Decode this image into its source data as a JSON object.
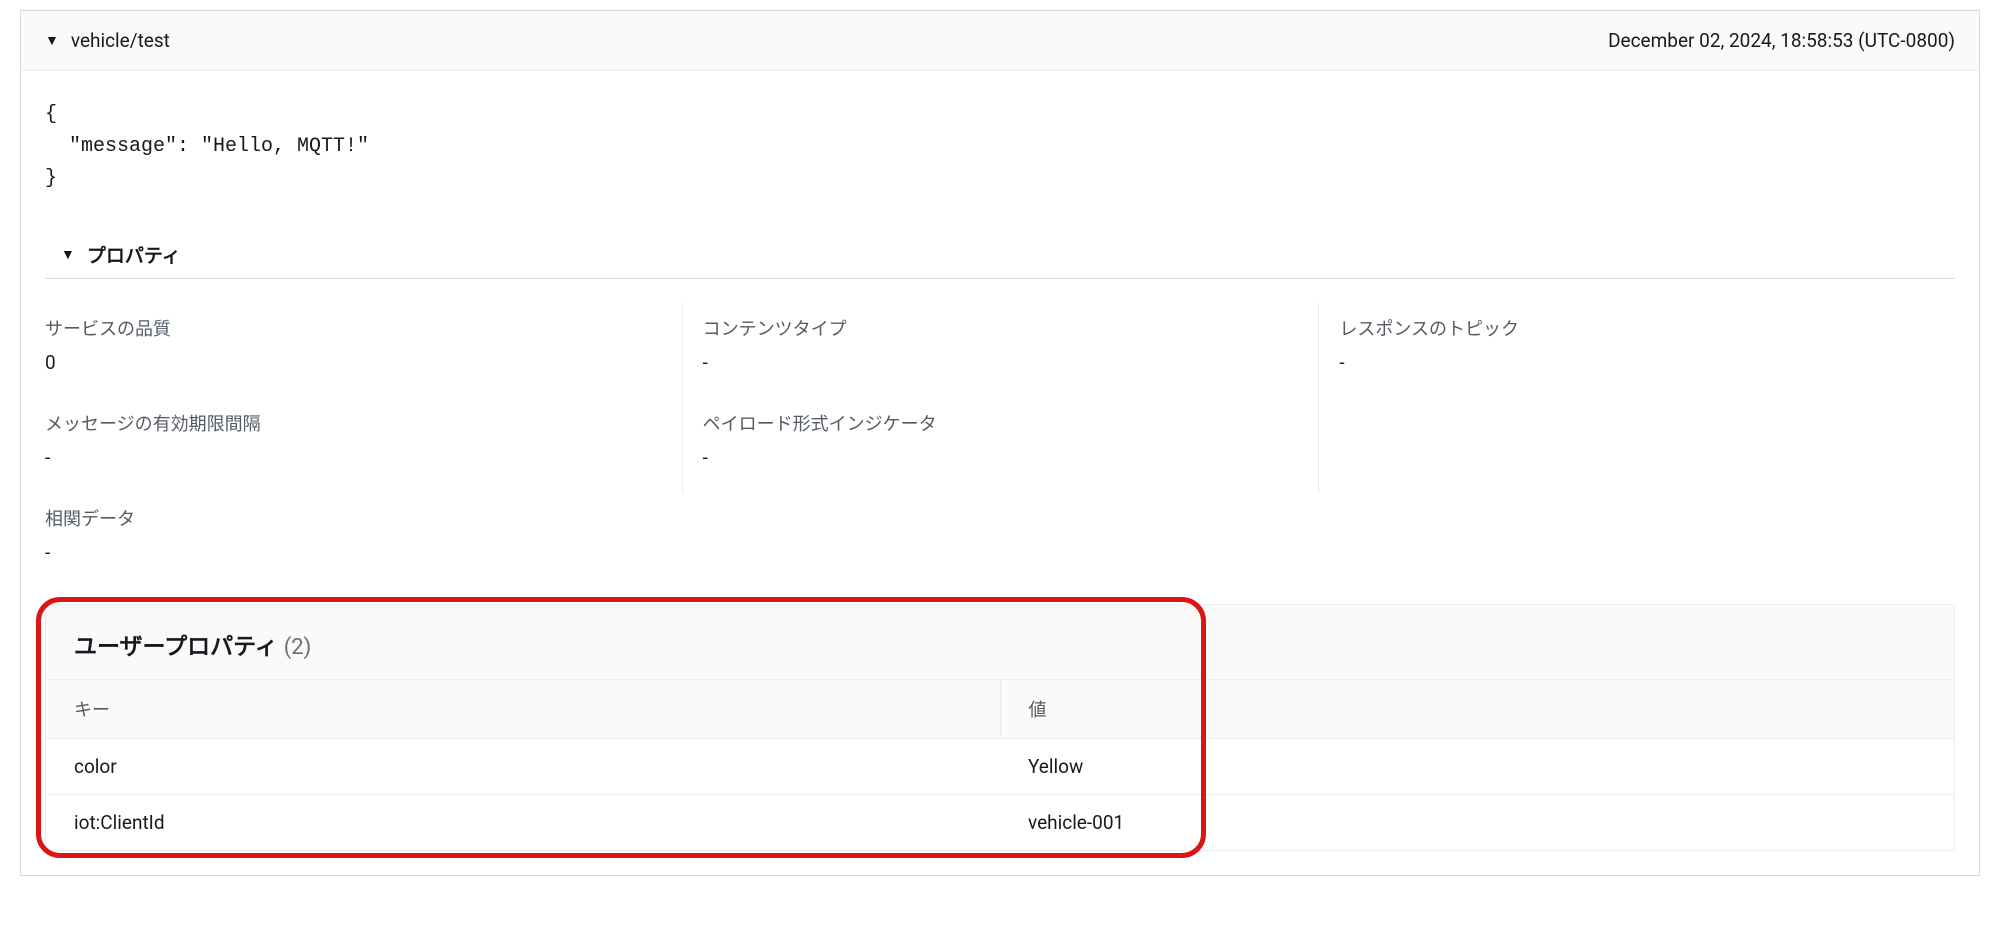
{
  "topic": {
    "name": "vehicle/test",
    "timestamp": "December 02, 2024, 18:58:53 (UTC-0800)"
  },
  "payload": "{\n  \"message\": \"Hello, MQTT!\"\n}",
  "propertiesHeader": "プロパティ",
  "properties": {
    "row1": [
      {
        "label": "サービスの品質",
        "value": "0"
      },
      {
        "label": "コンテンツタイプ",
        "value": "-"
      },
      {
        "label": "レスポンスのトピック",
        "value": "-"
      }
    ],
    "row2": [
      {
        "label": "メッセージの有効期限間隔",
        "value": "-"
      },
      {
        "label": "ペイロード形式インジケータ",
        "value": "-"
      }
    ],
    "correlation": {
      "label": "相関データ",
      "value": "-"
    }
  },
  "userProperties": {
    "title": "ユーザープロパティ",
    "count": "(2)",
    "columns": {
      "key": "キー",
      "value": "値"
    },
    "rows": [
      {
        "key": "color",
        "value": "Yellow"
      },
      {
        "key": "iot:ClientId",
        "value": "vehicle-001"
      }
    ]
  }
}
